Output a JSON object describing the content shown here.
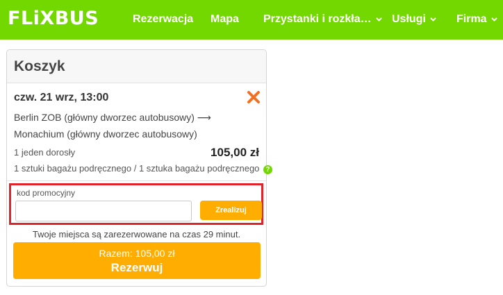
{
  "header": {
    "logo": "FLiXBUS",
    "nav": [
      {
        "label": "Rezerwacja",
        "dropdown": false
      },
      {
        "label": "Mapa",
        "dropdown": false
      },
      {
        "label": "Przystanki i rozkła…",
        "dropdown": true
      },
      {
        "label": "Usługi",
        "dropdown": true
      },
      {
        "label": "Firma",
        "dropdown": true
      }
    ]
  },
  "cart": {
    "title": "Koszyk",
    "trip": {
      "date": "czw. 21 wrz, 13:00",
      "route": "Berlin ZOB (główny dworzec autobusowy) ⟶ Monachium (główny dworzec autobusowy)",
      "passengers": "1 jeden dorosły",
      "price": "105,00 zł",
      "baggage": "1 sztuki bagażu podręcznego / 1 sztuka bagażu podręcznego"
    },
    "promo": {
      "label": "kod promocyjny",
      "value": "",
      "placeholder": "",
      "button": "Zrealizuj"
    },
    "note": "Twoje miejsca są zarezerwowane na czas 29 minut.",
    "checkout": {
      "total": "Razem: 105,00 zł",
      "button": "Rezerwuj"
    }
  },
  "colors": {
    "brand_green": "#73d700",
    "accent_orange": "#ffad00",
    "remove_icon": "#f36f21",
    "highlight_border": "#e0232b"
  },
  "icons": {
    "remove": "close-x-icon",
    "help": "question-mark-icon",
    "dropdown": "chevron-down-icon"
  }
}
